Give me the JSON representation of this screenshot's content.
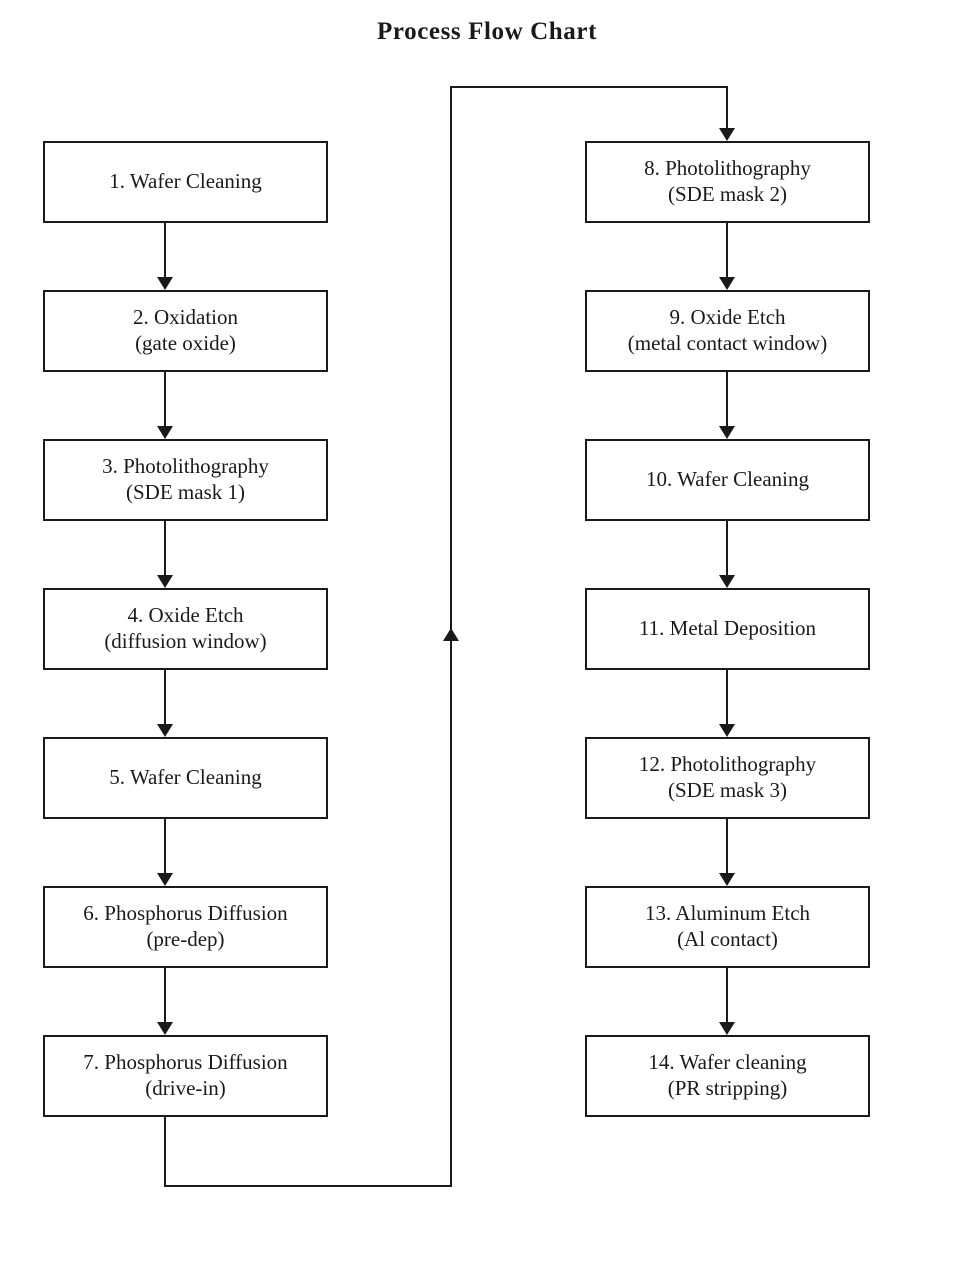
{
  "title": "Process Flow Chart",
  "colors": {
    "stroke": "#1a1a1a",
    "background": "#ffffff",
    "text": "#1a1a1a"
  },
  "diagram": {
    "type": "flowchart",
    "orientation": "two-column-serpentine",
    "node_count": 14,
    "left_column": [
      {
        "id": "step-1",
        "number": "1.",
        "line1": "1. Wafer Cleaning",
        "line2": ""
      },
      {
        "id": "step-2",
        "number": "2.",
        "line1": "2.  Oxidation",
        "line2": "(gate oxide)"
      },
      {
        "id": "step-3",
        "number": "3.",
        "line1": "3. Photolithography",
        "line2": "(SDE mask 1)"
      },
      {
        "id": "step-4",
        "number": "4.",
        "line1": "4. Oxide Etch",
        "line2": "(diffusion window)"
      },
      {
        "id": "step-5",
        "number": "5.",
        "line1": "5. Wafer Cleaning",
        "line2": ""
      },
      {
        "id": "step-6",
        "number": "6.",
        "line1": "6. Phosphorus Diffusion",
        "line2": "(pre-dep)"
      },
      {
        "id": "step-7",
        "number": "7.",
        "line1": "7. Phosphorus Diffusion",
        "line2": "(drive-in)"
      }
    ],
    "right_column": [
      {
        "id": "step-8",
        "number": "8.",
        "line1": "8. Photolithography",
        "line2": "(SDE mask 2)"
      },
      {
        "id": "step-9",
        "number": "9.",
        "line1": "9.  Oxide Etch",
        "line2": "(metal contact window)"
      },
      {
        "id": "step-10",
        "number": "10.",
        "line1": "10. Wafer Cleaning",
        "line2": ""
      },
      {
        "id": "step-11",
        "number": "11.",
        "line1": "11. Metal Deposition",
        "line2": ""
      },
      {
        "id": "step-12",
        "number": "12.",
        "line1": "12. Photolithography",
        "line2": "(SDE mask 3)"
      },
      {
        "id": "step-13",
        "number": "13.",
        "line1": "13.  Aluminum Etch",
        "line2": "(Al contact)"
      },
      {
        "id": "step-14",
        "number": "14.",
        "line1": "14. Wafer cleaning",
        "line2": "(PR stripping)"
      }
    ],
    "edges": [
      {
        "from": "step-1",
        "to": "step-2",
        "style": "straight-down"
      },
      {
        "from": "step-2",
        "to": "step-3",
        "style": "straight-down"
      },
      {
        "from": "step-3",
        "to": "step-4",
        "style": "straight-down"
      },
      {
        "from": "step-4",
        "to": "step-5",
        "style": "straight-down"
      },
      {
        "from": "step-5",
        "to": "step-6",
        "style": "straight-down"
      },
      {
        "from": "step-6",
        "to": "step-7",
        "style": "straight-down"
      },
      {
        "from": "step-7",
        "to": "step-8",
        "style": "serpentine-down-right-up-right-down"
      },
      {
        "from": "step-8",
        "to": "step-9",
        "style": "straight-down"
      },
      {
        "from": "step-9",
        "to": "step-10",
        "style": "straight-down"
      },
      {
        "from": "step-10",
        "to": "step-11",
        "style": "straight-down"
      },
      {
        "from": "step-11",
        "to": "step-12",
        "style": "straight-down"
      },
      {
        "from": "step-12",
        "to": "step-13",
        "style": "straight-down"
      },
      {
        "from": "step-13",
        "to": "step-14",
        "style": "straight-down"
      }
    ]
  }
}
